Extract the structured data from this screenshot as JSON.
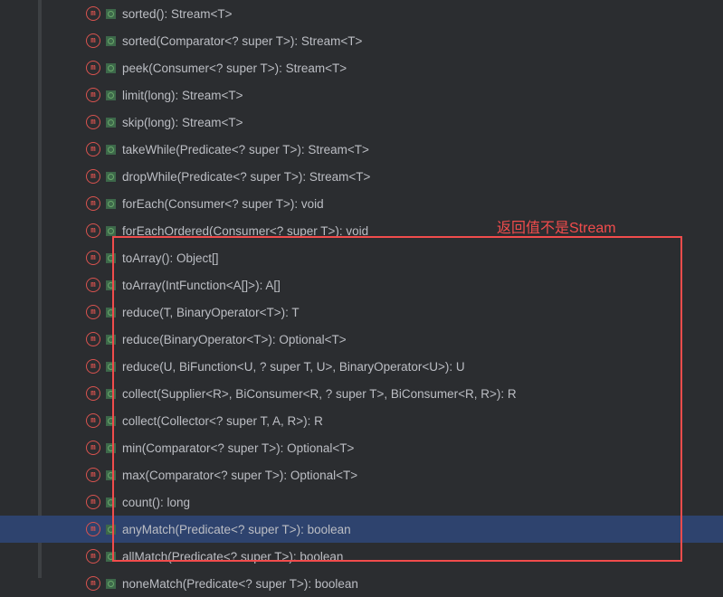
{
  "annotation": "返回值不是Stream",
  "methods": [
    {
      "label": "sorted(): Stream<T>",
      "selected": false
    },
    {
      "label": "sorted(Comparator<? super T>): Stream<T>",
      "selected": false
    },
    {
      "label": "peek(Consumer<? super T>): Stream<T>",
      "selected": false
    },
    {
      "label": "limit(long): Stream<T>",
      "selected": false
    },
    {
      "label": "skip(long): Stream<T>",
      "selected": false
    },
    {
      "label": "takeWhile(Predicate<? super T>): Stream<T>",
      "selected": false
    },
    {
      "label": "dropWhile(Predicate<? super T>): Stream<T>",
      "selected": false
    },
    {
      "label": "forEach(Consumer<? super T>): void",
      "selected": false
    },
    {
      "label": "forEachOrdered(Consumer<? super T>): void",
      "selected": false
    },
    {
      "label": "toArray(): Object[]",
      "selected": false
    },
    {
      "label": "toArray(IntFunction<A[]>): A[]",
      "selected": false
    },
    {
      "label": "reduce(T, BinaryOperator<T>): T",
      "selected": false
    },
    {
      "label": "reduce(BinaryOperator<T>): Optional<T>",
      "selected": false
    },
    {
      "label": "reduce(U, BiFunction<U, ? super T, U>, BinaryOperator<U>): U",
      "selected": false
    },
    {
      "label": "collect(Supplier<R>, BiConsumer<R, ? super T>, BiConsumer<R, R>): R",
      "selected": false
    },
    {
      "label": "collect(Collector<? super T, A, R>): R",
      "selected": false
    },
    {
      "label": "min(Comparator<? super T>): Optional<T>",
      "selected": false
    },
    {
      "label": "max(Comparator<? super T>): Optional<T>",
      "selected": false
    },
    {
      "label": "count(): long",
      "selected": false
    },
    {
      "label": "anyMatch(Predicate<? super T>): boolean",
      "selected": true
    },
    {
      "label": "allMatch(Predicate<? super T>): boolean",
      "selected": false
    },
    {
      "label": "noneMatch(Predicate<? super T>): boolean",
      "selected": false
    }
  ]
}
